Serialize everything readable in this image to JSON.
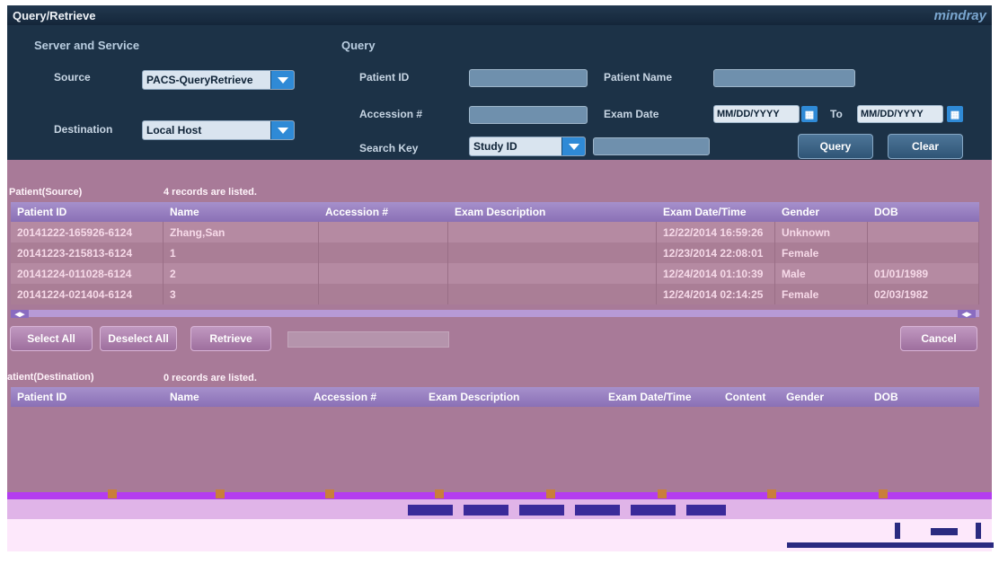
{
  "window": {
    "title": "Query/Retrieve",
    "brand": "mindray"
  },
  "server": {
    "title": "Server and Service",
    "source_label": "Source",
    "source_value": "PACS-QueryRetrieve",
    "destination_label": "Destination",
    "destination_value": "Local Host"
  },
  "query": {
    "title": "Query",
    "patient_id_label": "Patient ID",
    "patient_id_value": "",
    "patient_name_label": "Patient Name",
    "patient_name_value": "",
    "accession_label": "Accession #",
    "accession_value": "",
    "exam_date_label": "Exam Date",
    "date_from_placeholder": "MM/DD/YYYY",
    "to_label": "To",
    "date_to_placeholder": "MM/DD/YYYY",
    "search_key_label": "Search Key",
    "search_key_value": "Study ID",
    "search_key_text": "",
    "query_button": "Query",
    "clear_button": "Clear"
  },
  "source_table": {
    "caption": "Patient(Source)",
    "count": "4 records are listed.",
    "columns": [
      "Patient ID",
      "Name",
      "Accession #",
      "Exam Description",
      "Exam Date/Time",
      "Gender",
      "DOB"
    ],
    "rows": [
      [
        "20141222-165926-6124",
        "Zhang,San",
        "",
        "",
        "12/22/2014 16:59:26",
        "Unknown",
        ""
      ],
      [
        "20141223-215813-6124",
        "1",
        "",
        "",
        "12/23/2014 22:08:01",
        "Female",
        ""
      ],
      [
        "20141224-011028-6124",
        "2",
        "",
        "",
        "12/24/2014 01:10:39",
        "Male",
        "01/01/1989"
      ],
      [
        "20141224-021404-6124",
        "3",
        "",
        "",
        "12/24/2014 02:14:25",
        "Female",
        "02/03/1982"
      ]
    ]
  },
  "actions": {
    "select_all": "Select All",
    "deselect_all": "Deselect All",
    "retrieve": "Retrieve",
    "cancel": "Cancel"
  },
  "dest_table": {
    "caption": "atient(Destination)",
    "count": "0 records are listed.",
    "columns": [
      "Patient ID",
      "Name",
      "Accession #",
      "Exam Description",
      "Exam Date/Time",
      "Content",
      "Gender",
      "DOB"
    ]
  },
  "colors": {
    "title_bar": "#1c3247",
    "accent_blue": "#2f8ad6",
    "pink_panel": "#a87a98",
    "table_header": "#9a80c2"
  }
}
